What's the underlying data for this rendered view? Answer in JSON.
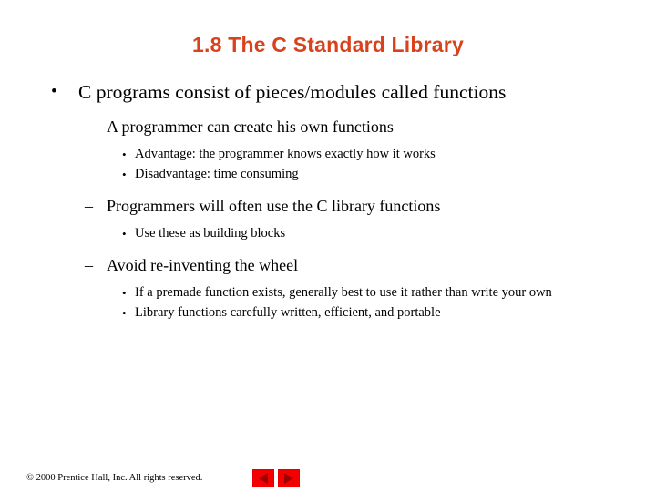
{
  "slide": {
    "title": "1.8 The C Standard Library",
    "title_color": "#d8431e",
    "background_color": "#ffffff",
    "text_color": "#000000"
  },
  "content": {
    "markers": {
      "level1": "•",
      "level2": "–",
      "level3": "•"
    },
    "items": [
      {
        "level": 1,
        "text": "C programs consist of pieces/modules called functions"
      },
      {
        "level": 2,
        "text": "A programmer can create his own functions"
      },
      {
        "level": 3,
        "text": "Advantage: the programmer knows exactly how it works"
      },
      {
        "level": 3,
        "text": "Disadvantage: time consuming"
      },
      {
        "level": 2,
        "text": "Programmers will often use the C library functions"
      },
      {
        "level": 3,
        "text": "Use these as building blocks"
      },
      {
        "level": 2,
        "text": "Avoid re-inventing the wheel"
      },
      {
        "level": 3,
        "text": "If a premade function exists, generally best to use it rather than write your own"
      },
      {
        "level": 3,
        "text": "Library functions carefully written, efficient, and portable"
      }
    ]
  },
  "footer": {
    "copyright": "© 2000 Prentice Hall, Inc.  All rights reserved.",
    "nav": {
      "previous_label": "◀",
      "next_label": "▶",
      "button_color": "#f40000",
      "arrow_color": "#9e0000"
    }
  }
}
